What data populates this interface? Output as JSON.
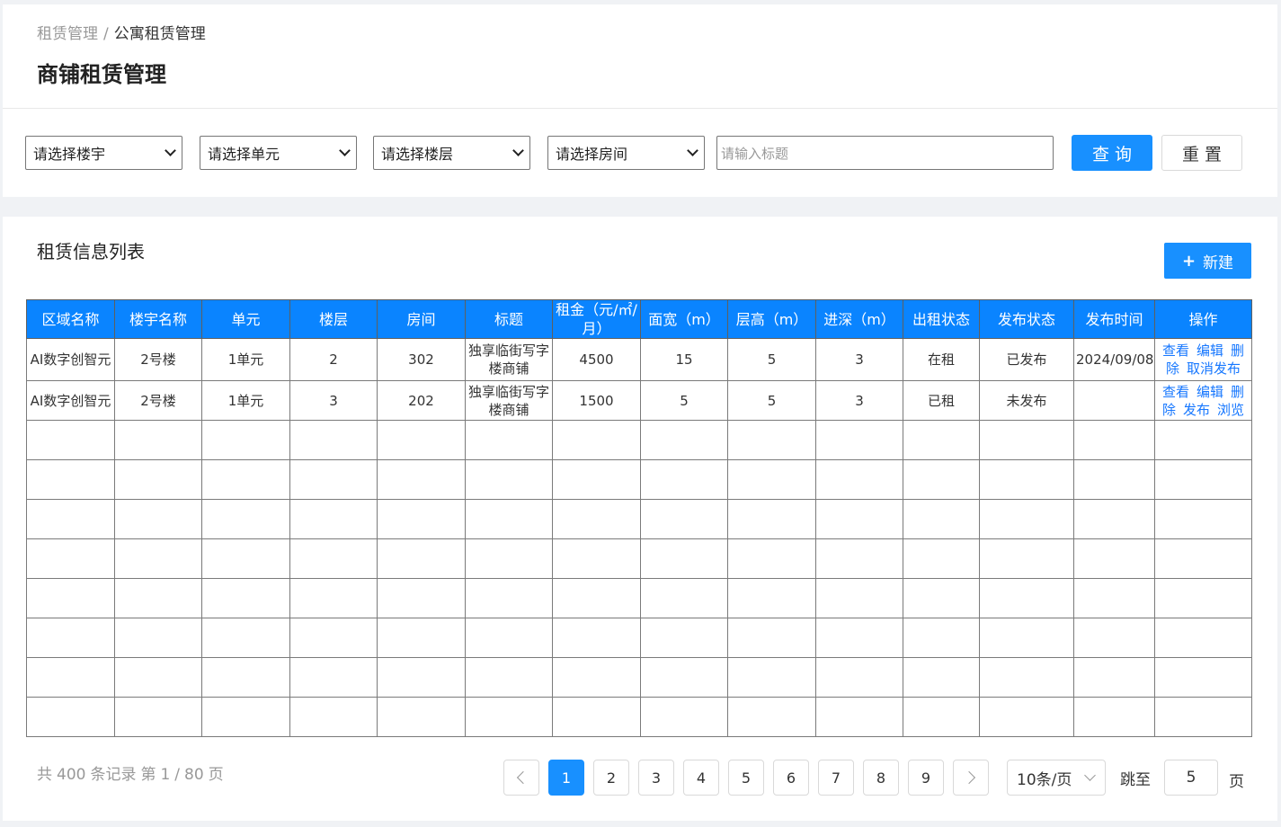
{
  "breadcrumb": {
    "parent": "租赁管理",
    "separator": "/",
    "current": "公寓租赁管理"
  },
  "page_title": "商铺租赁管理",
  "filters": {
    "building_select": "请选择楼宇",
    "unit_select": "请选择单元",
    "floor_select": "请选择楼层",
    "room_select": "请选择房间",
    "title_placeholder": "请输入标题",
    "query_label": "查询",
    "reset_label": "重置"
  },
  "list": {
    "title": "租赁信息列表",
    "new_button": {
      "icon": "plus-icon",
      "symbol": "+",
      "label": "新建"
    },
    "columns": [
      "区域名称",
      "楼宇名称",
      "单元",
      "楼层",
      "房间",
      "标题",
      "租金（元/㎡/月）",
      "面宽（m）",
      "层高（m）",
      "进深（m）",
      "出租状态",
      "发布状态",
      "发布时间",
      "操作"
    ],
    "rows": [
      {
        "area": "AI数字创智元",
        "building": "2号楼",
        "unit": "1单元",
        "floor": "2",
        "room": "302",
        "title": "独享临街写字楼商铺",
        "rent": "4500",
        "width": "15",
        "height": "5",
        "depth": "3",
        "rent_status": "在租",
        "publish_status": "已发布",
        "publish_time": "2024/09/08",
        "actions": [
          "查看",
          "编辑",
          "删除",
          "取消发布"
        ]
      },
      {
        "area": "AI数字创智元",
        "building": "2号楼",
        "unit": "1单元",
        "floor": "3",
        "room": "202",
        "title": "独享临街写字楼商铺",
        "rent": "1500",
        "width": "5",
        "height": "5",
        "depth": "3",
        "rent_status": "已租",
        "publish_status": "未发布",
        "publish_time": "",
        "actions": [
          "查看",
          "编辑",
          "删除",
          "发布",
          "浏览"
        ]
      }
    ]
  },
  "pagination": {
    "total_prefix": "共",
    "total": "400",
    "total_suffix": "条记录",
    "page_prefix": "第",
    "page_current": "1",
    "page_sep": "/",
    "page_total": "80",
    "page_suffix": "页",
    "pages": [
      "1",
      "2",
      "3",
      "4",
      "5",
      "6",
      "7",
      "8",
      "9"
    ],
    "active_page": "1",
    "page_size": "10条/页",
    "jump_label": "跳至",
    "jump_value": "5",
    "page_unit": "页"
  },
  "colors": {
    "accent": "#1890ff",
    "header_bg": "#0a84ff",
    "link": "#1677ff"
  }
}
